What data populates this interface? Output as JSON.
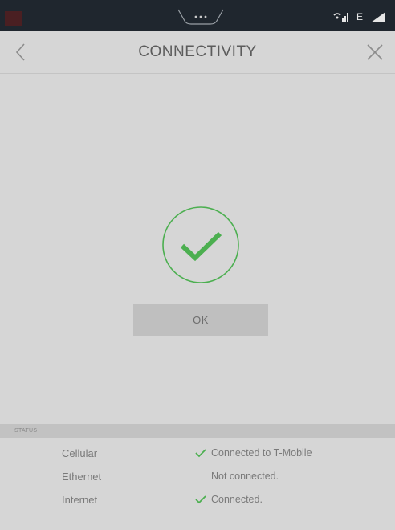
{
  "app": {
    "title": "CONNECTIVITY"
  },
  "status_bar": {
    "network_letter": "E",
    "icons": [
      "wifi-signal-icon",
      "cell-signal-icon",
      "battery-icon"
    ]
  },
  "header": {
    "back_icon": "chevron-left-icon",
    "close_icon": "close-icon"
  },
  "main": {
    "success_icon": "check-circle-icon",
    "ok_label": "OK"
  },
  "status": {
    "section_label": "STATUS",
    "rows": [
      {
        "label": "Cellular",
        "value": "Connected to T-Mobile",
        "ok": true
      },
      {
        "label": "Ethernet",
        "value": "Not connected.",
        "ok": false
      },
      {
        "label": "Internet",
        "value": "Connected.",
        "ok": true
      }
    ]
  },
  "colors": {
    "accent_green": "#4caf50",
    "background": "#d6d6d6",
    "status_bar": "#1f262e",
    "button": "#bfbfbf",
    "text": "#7a7a7a"
  }
}
